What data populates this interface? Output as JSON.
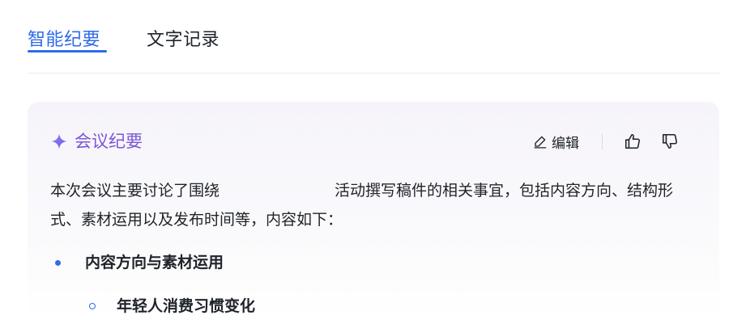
{
  "tabs": {
    "active_label": "智能纪要",
    "inactive_label": "文字记录"
  },
  "card": {
    "title": "会议纪要",
    "title_icon": "sparkle-icon",
    "edit_label": "编辑",
    "edit_icon": "pencil-icon",
    "like_icon": "thumbs-up-icon",
    "dislike_icon": "thumbs-down-icon",
    "summary_before": "本次会议主要讨论了围绕",
    "summary_after": "活动撰写稿件的相关事宜，包括内容方向、结构形式、素材运用以及发布时间等，内容如下：",
    "bullets": [
      {
        "label": "内容方向与素材运用"
      }
    ],
    "sub_bullets": [
      {
        "label": "年轻人消费习惯变化"
      }
    ]
  },
  "colors": {
    "accent_blue": "#2f6bea",
    "accent_purple": "#7b57d6",
    "text_primary": "#1f2329"
  }
}
